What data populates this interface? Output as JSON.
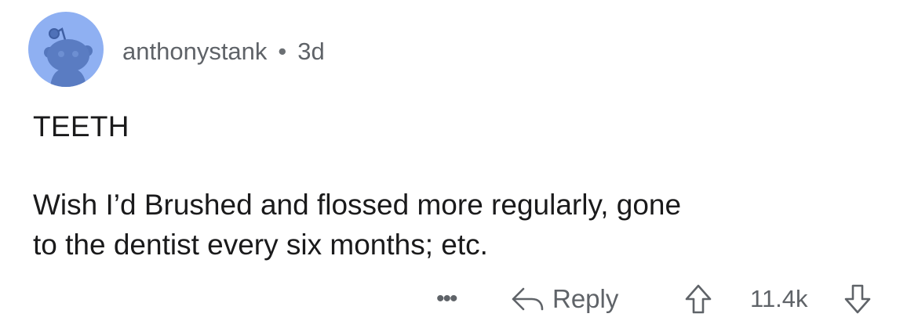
{
  "comment": {
    "author": "anthonystank",
    "separator": "•",
    "age": "3d",
    "title": "TEETH",
    "body_lines": [
      "Wish I’d Brushed and flossed more regularly, gone",
      "to the dentist every six months; etc."
    ]
  },
  "actions": {
    "more_label": "•••",
    "reply_label": "Reply",
    "score": "11.4k"
  },
  "icons": {
    "avatar": "snoo-avatar-icon",
    "reply": "reply-arrow-icon",
    "upvote": "upvote-arrow-icon",
    "downvote": "downvote-arrow-icon"
  },
  "colors": {
    "avatar_background": "#8fb0f2",
    "avatar_figure": "#4f71b8",
    "muted_text": "#5f6368",
    "primary_text": "#1a1a1b"
  }
}
